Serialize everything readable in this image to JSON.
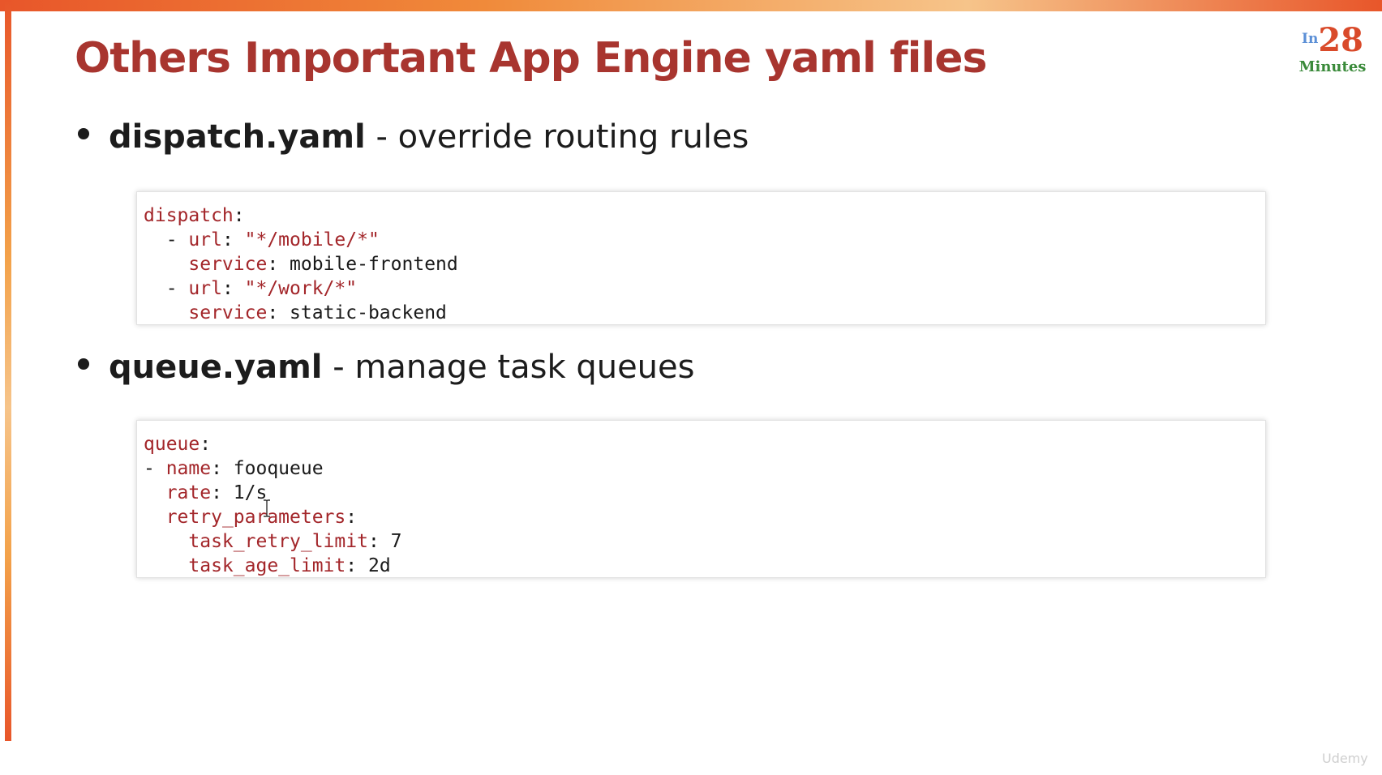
{
  "slide": {
    "title": "Others Important App Engine yaml files",
    "logo": {
      "prefix": "In",
      "number": "28",
      "word": "Minutes"
    },
    "bullets": [
      {
        "name_bold": "dispatch.yaml",
        "description": " - override routing rules",
        "code_lines": [
          {
            "indent": "",
            "key": "dispatch",
            "sep": ":",
            "value": "",
            "value_is_string": false
          },
          {
            "indent": "  - ",
            "key": "url",
            "sep": ": ",
            "value": "\"*/mobile/*\"",
            "value_is_string": true
          },
          {
            "indent": "    ",
            "key": "service",
            "sep": ": ",
            "value": "mobile-frontend",
            "value_is_string": false
          },
          {
            "indent": "  - ",
            "key": "url",
            "sep": ": ",
            "value": "\"*/work/*\"",
            "value_is_string": true
          },
          {
            "indent": "    ",
            "key": "service",
            "sep": ": ",
            "value": "static-backend",
            "value_is_string": false
          }
        ]
      },
      {
        "name_bold": "queue.yaml",
        "description": " - manage task queues",
        "code_lines": [
          {
            "indent": "",
            "key": "queue",
            "sep": ":",
            "value": "",
            "value_is_string": false
          },
          {
            "indent": "- ",
            "key": "name",
            "sep": ": ",
            "value": "fooqueue",
            "value_is_string": false
          },
          {
            "indent": "  ",
            "key": "rate",
            "sep": ": ",
            "value": "1/s",
            "value_is_string": false
          },
          {
            "indent": "  ",
            "key": "retry_parameters",
            "sep": ":",
            "value": "",
            "value_is_string": false
          },
          {
            "indent": "    ",
            "key": "task_retry_limit",
            "sep": ": ",
            "value": "7",
            "value_is_string": false
          },
          {
            "indent": "    ",
            "key": "task_age_limit",
            "sep": ": ",
            "value": "2d",
            "value_is_string": false
          }
        ]
      }
    ],
    "watermark": "Udemy"
  },
  "colors": {
    "title": "#a8352f",
    "yaml_key": "#a3262a",
    "accent_bar": "#e8562a"
  },
  "icons": {
    "cursor": "text-cursor-icon",
    "logo": "in28minutes-logo-icon"
  }
}
